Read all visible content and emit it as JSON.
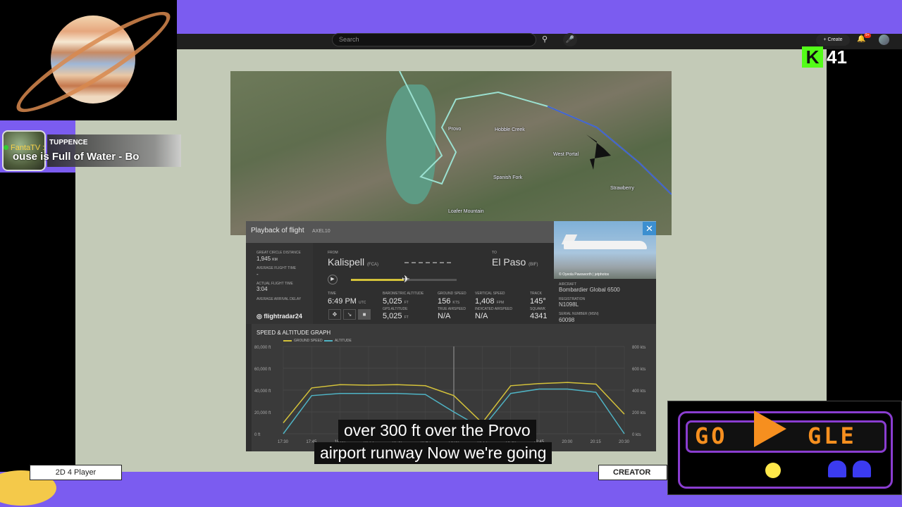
{
  "browser": {
    "search_placeholder": "Search",
    "create_label": "Create",
    "notification_count": "9+"
  },
  "overlay": {
    "alert_user": "TUPPENCE",
    "alert_name": "FantaTV :",
    "alert_message": "ouse is Full of Water - Bo",
    "kick_viewers": "41",
    "bottom_left_label": "2D 4 Player",
    "bottom_right_label": "CREATOR"
  },
  "flight": {
    "panel_title": "Playback of flight",
    "flight_code": "AXEL10",
    "great_circle_distance_label": "GREAT CIRCLE DISTANCE",
    "great_circle_distance_value": "1,945",
    "great_circle_distance_unit": "KM",
    "average_flight_time_label": "AVERAGE FLIGHT TIME",
    "average_flight_time_value": "-",
    "actual_flight_time_label": "ACTUAL FLIGHT TIME",
    "actual_flight_time_value": "3:04",
    "average_arrival_delay_label": "AVERAGE ARRIVAL DELAY",
    "logo_text": "flightradar24",
    "from_label": "FROM",
    "from_city": "Kalispell",
    "from_code": "(FCA)",
    "to_label": "TO",
    "to_city": "El Paso",
    "to_code": "(BIF)",
    "progress": 0.5,
    "time_label": "TIME",
    "time_value": "6:49 PM",
    "time_unit": "UTC",
    "baro_alt_label": "BAROMETRIC ALTITUDE",
    "baro_alt_value": "5,025",
    "baro_alt_unit": "FT",
    "gps_alt_label": "GPS ALTITUDE",
    "gps_alt_value": "5,025",
    "gps_alt_unit": "FT",
    "ground_speed_label": "GROUND SPEED",
    "ground_speed_value": "156",
    "ground_speed_unit": "KTS",
    "true_airspeed_label": "TRUE AIRSPEED",
    "true_airspeed_value": "N/A",
    "vertical_speed_label": "VERTICAL SPEED",
    "vertical_speed_value": "1,408",
    "vertical_speed_unit": "FPM",
    "indicated_airspeed_label": "INDICATED AIRSPEED",
    "indicated_airspeed_value": "N/A",
    "track_label": "TRACK",
    "track_value": "145°",
    "squawk_label": "SQUAWK",
    "squawk_value": "4341",
    "photo_credit": "© Oyeola Pawsworth | jetphotos",
    "aircraft_label": "AIRCRAFT",
    "aircraft_value": "Bombardier Global 6500",
    "registration_label": "REGISTRATION",
    "registration_value": "N1098L",
    "serial_label": "SERIAL NUMBER (MSN)",
    "serial_value": "60098"
  },
  "map_labels": [
    "Provo",
    "Hobble Creek",
    "Spanish Fork",
    "West Portal",
    "Strawberry",
    "Loafer Mountain"
  ],
  "chart_data": {
    "type": "line",
    "title": "SPEED & ALTITUDE GRAPH",
    "x_ticks": [
      "17:30",
      "17:45",
      "18:00",
      "18:15",
      "18:30",
      "18:45",
      "19:00",
      "19:15",
      "19:30",
      "19:45",
      "20:00",
      "20:15",
      "20:30"
    ],
    "left_axis_ticks": [
      "80,000 ft",
      "60,000 ft",
      "40,000 ft",
      "20,000 ft",
      "0 ft"
    ],
    "right_axis_ticks": [
      "800 kts",
      "600 kts",
      "400 kts",
      "200 kts",
      "0 kts"
    ],
    "series": [
      {
        "name": "GROUND SPEED",
        "color": "#d4c23a",
        "values": [
          100,
          420,
          450,
          445,
          450,
          440,
          350,
          100,
          440,
          460,
          470,
          455,
          180
        ]
      },
      {
        "name": "ALTITUDE",
        "color": "#4fb3c4",
        "values": [
          0,
          35000,
          37000,
          37000,
          37000,
          36000,
          20000,
          5000,
          37000,
          41000,
          41000,
          38000,
          0
        ]
      }
    ],
    "ylim_left": [
      0,
      80000
    ],
    "ylim_right": [
      0,
      800
    ]
  },
  "subtitles": [
    "over 300 ft over the Provo",
    "airport runway Now we're going"
  ],
  "game": {
    "text_left": "GO",
    "text_right": "GLE"
  }
}
